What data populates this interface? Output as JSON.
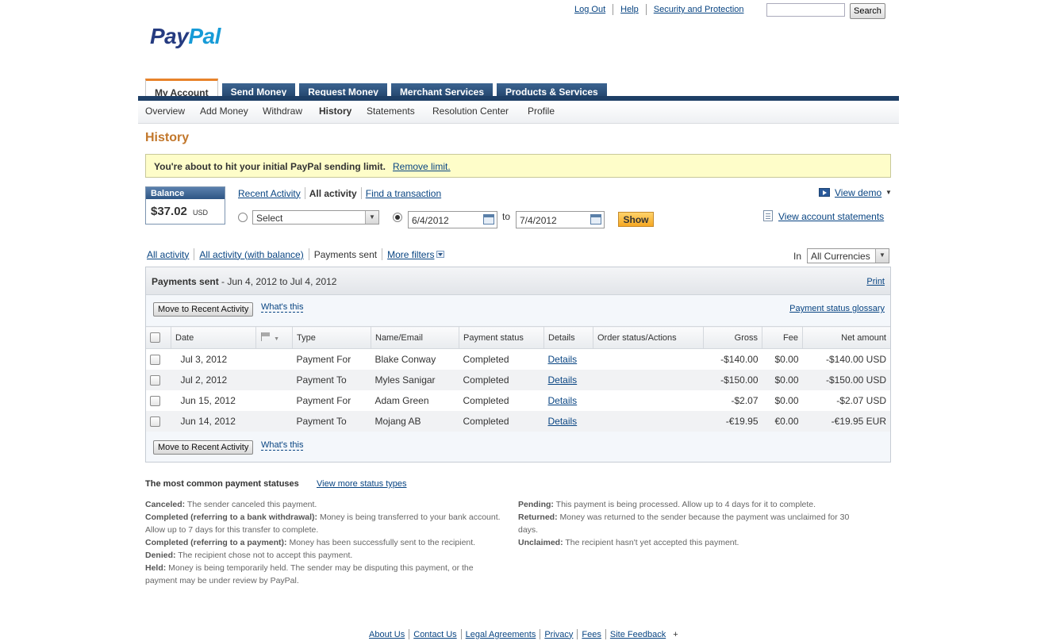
{
  "top_links": [
    "Log Out",
    "Help",
    "Security and Protection"
  ],
  "search": {
    "button": "Search",
    "value": ""
  },
  "logo": {
    "part1": "Pay",
    "part2": "Pal"
  },
  "tabs": [
    "My Account",
    "Send Money",
    "Request Money",
    "Merchant Services",
    "Products & Services"
  ],
  "subnav": [
    "Overview",
    "Add Money",
    "Withdraw",
    "History",
    "Statements",
    "Resolution Center",
    "Profile"
  ],
  "page_title": "History",
  "alert": {
    "message": "You're about to hit your initial PayPal sending limit.",
    "link": "Remove limit."
  },
  "balance": {
    "label": "Balance",
    "amount": "$37.02",
    "currency": "USD"
  },
  "view_links": {
    "recent": "Recent Activity",
    "all": "All activity",
    "find": "Find a transaction"
  },
  "filter_form": {
    "select_value": "Select",
    "from_date": "6/4/2012",
    "to_label": "to",
    "to_date": "7/4/2012",
    "show_button": "Show"
  },
  "right_links": {
    "demo": "View demo",
    "statements": "View account statements"
  },
  "activity_filters": {
    "all": "All activity",
    "all_balance": "All activity (with balance)",
    "sent": "Payments sent",
    "more": "More filters",
    "in_label": "In",
    "currency": "All Currencies"
  },
  "panel": {
    "title": "Payments sent",
    "range": " - Jun 4, 2012 to Jul 4, 2012",
    "print": "Print",
    "move_button": "Move to Recent Activity",
    "whats_this": "What's this",
    "glossary": "Payment status glossary"
  },
  "table": {
    "headers": {
      "date": "Date",
      "type": "Type",
      "name": "Name/Email",
      "status": "Payment status",
      "details": "Details",
      "order": "Order status/Actions",
      "gross": "Gross",
      "fee": "Fee",
      "net": "Net amount"
    },
    "rows": [
      {
        "date": "Jul 3, 2012",
        "type": "Payment For",
        "name": "Blake Conway",
        "status": "Completed",
        "details": "Details",
        "gross": "-$140.00",
        "fee": "$0.00",
        "net": "-$140.00 USD"
      },
      {
        "date": "Jul 2, 2012",
        "type": "Payment To",
        "name": "Myles Sanigar",
        "status": "Completed",
        "details": "Details",
        "gross": "-$150.00",
        "fee": "$0.00",
        "net": "-$150.00 USD"
      },
      {
        "date": "Jun 15, 2012",
        "type": "Payment For",
        "name": "Adam Green",
        "status": "Completed",
        "details": "Details",
        "gross": "-$2.07",
        "fee": "$0.00",
        "net": "-$2.07 USD"
      },
      {
        "date": "Jun 14, 2012",
        "type": "Payment To",
        "name": "Mojang AB",
        "status": "Completed",
        "details": "Details",
        "gross": "-€19.95",
        "fee": "€0.00",
        "net": "-€19.95 EUR"
      }
    ]
  },
  "statuses": {
    "title": "The most common payment statuses",
    "link": "View more status types",
    "left": [
      {
        "term": "Canceled:",
        "text": " The sender canceled this payment."
      },
      {
        "term": "Completed (referring to a bank withdrawal):",
        "text": " Money is being transferred to your bank account. Allow up to 7 days for this transfer to complete."
      },
      {
        "term": "Completed (referring to a payment):",
        "text": " Money has been successfully sent to the recipient."
      },
      {
        "term": "Denied:",
        "text": " The recipient chose not to accept this payment."
      },
      {
        "term": "Held:",
        "text": " Money is being temporarily held. The sender may be disputing this payment, or the payment may be under review by PayPal."
      }
    ],
    "right": [
      {
        "term": "Pending:",
        "text": " This payment is being processed. Allow up to 4 days for it to complete."
      },
      {
        "term": "Returned:",
        "text": " Money was returned to the sender because the payment was unclaimed for 30 days."
      },
      {
        "term": "Unclaimed:",
        "text": " The recipient hasn't yet accepted this payment."
      }
    ]
  },
  "footer": [
    "About Us",
    "Contact Us",
    "Legal Agreements",
    "Privacy",
    "Fees",
    "Site Feedback"
  ],
  "footer_extra": "+",
  "colors": {
    "brand_dark": "#253b80",
    "brand_light": "#179bd7",
    "tab_bg": "#1e3f66",
    "title_orange": "#c2772b",
    "alert_bg": "#fefdc9",
    "link": "#084482"
  }
}
